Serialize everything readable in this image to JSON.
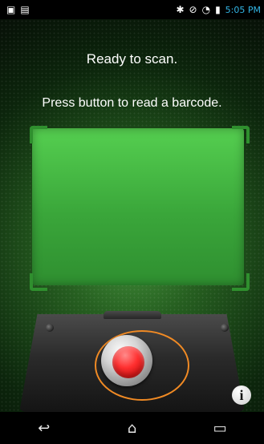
{
  "status_bar": {
    "left_icons": [
      "image-icon",
      "bag-icon"
    ],
    "right_icons": [
      "bluetooth-icon",
      "signal-off-icon",
      "wifi-icon",
      "battery-icon"
    ],
    "time": "5:05 PM"
  },
  "scanner": {
    "title": "Ready to scan.",
    "subtitle": "Press button to read a barcode."
  },
  "buttons": {
    "info": "i"
  },
  "navigation": {
    "back": "↩",
    "home": "⌂",
    "recent": "▭"
  }
}
